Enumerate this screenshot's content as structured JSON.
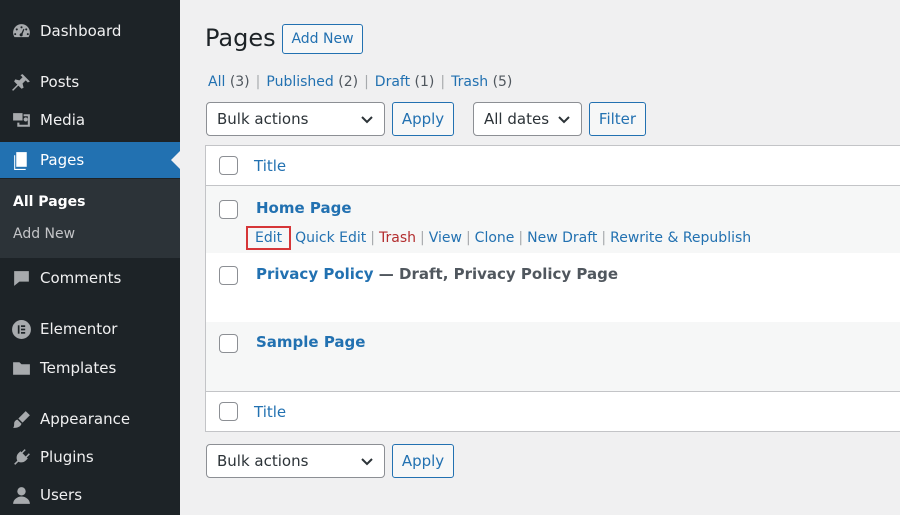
{
  "sidebar": {
    "menu": [
      {
        "label": "Dashboard",
        "icon": "dashboard-icon"
      },
      {
        "label": "Posts",
        "icon": "pin-icon"
      },
      {
        "label": "Media",
        "icon": "media-icon"
      },
      {
        "label": "Pages",
        "icon": "pages-icon",
        "active": true
      },
      {
        "label": "Comments",
        "icon": "comments-icon"
      },
      {
        "label": "Elementor",
        "icon": "elementor-icon"
      },
      {
        "label": "Templates",
        "icon": "folder-icon"
      },
      {
        "label": "Appearance",
        "icon": "brush-icon"
      },
      {
        "label": "Plugins",
        "icon": "plugin-icon"
      },
      {
        "label": "Users",
        "icon": "user-icon"
      }
    ],
    "submenu": [
      {
        "label": "All Pages",
        "current": true
      },
      {
        "label": "Add New"
      }
    ]
  },
  "header": {
    "title": "Pages",
    "add_new_label": "Add New"
  },
  "filters": {
    "views": [
      {
        "label": "All",
        "count": "(3)"
      },
      {
        "label": "Published",
        "count": "(2)"
      },
      {
        "label": "Draft",
        "count": "(1)"
      },
      {
        "label": "Trash",
        "count": "(5)"
      }
    ],
    "separator": "|",
    "bulk_actions": "Bulk actions",
    "apply_label": "Apply",
    "dates": "All dates",
    "filter_label": "Filter"
  },
  "table": {
    "column_title": "Title",
    "rows": [
      {
        "title": "Home Page",
        "state": ""
      },
      {
        "title": "Privacy Policy",
        "state": " — Draft, Privacy Policy Page"
      },
      {
        "title": "Sample Page",
        "state": ""
      }
    ],
    "row_actions": [
      "Edit",
      "Quick Edit",
      "Trash",
      "View",
      "Clone",
      "New Draft",
      "Rewrite & Republish"
    ]
  },
  "colors": {
    "sidebar_bg": "#1d2327",
    "accent": "#2271b1",
    "trash": "#b32d2e",
    "highlight": "#d63638"
  }
}
